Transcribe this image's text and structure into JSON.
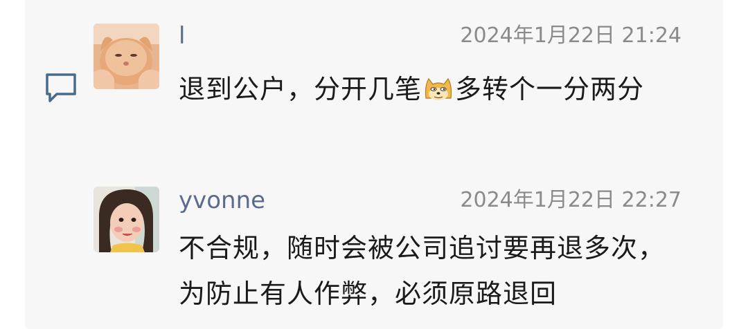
{
  "comments": [
    {
      "author": "l",
      "timestamp": "2024年1月22日 21:24",
      "text_before_emoji": "退到公户，分开几笔",
      "emoji": "doge-emoji",
      "text_after_emoji": "多转个一分两分"
    },
    {
      "author": "yvonne",
      "timestamp": "2024年1月22日 22:27",
      "text": "不合规，随时会被公司追讨要再退多次，为防止有人作弊，必须原路退回"
    }
  ],
  "icons": {
    "reply": "comment-icon"
  },
  "colors": {
    "author": "#5b6b8c",
    "timestamp": "#8a8a8a",
    "text": "#1a1a1a",
    "panel_bg": "#f7f7f7",
    "icon": "#4a6a8a"
  }
}
